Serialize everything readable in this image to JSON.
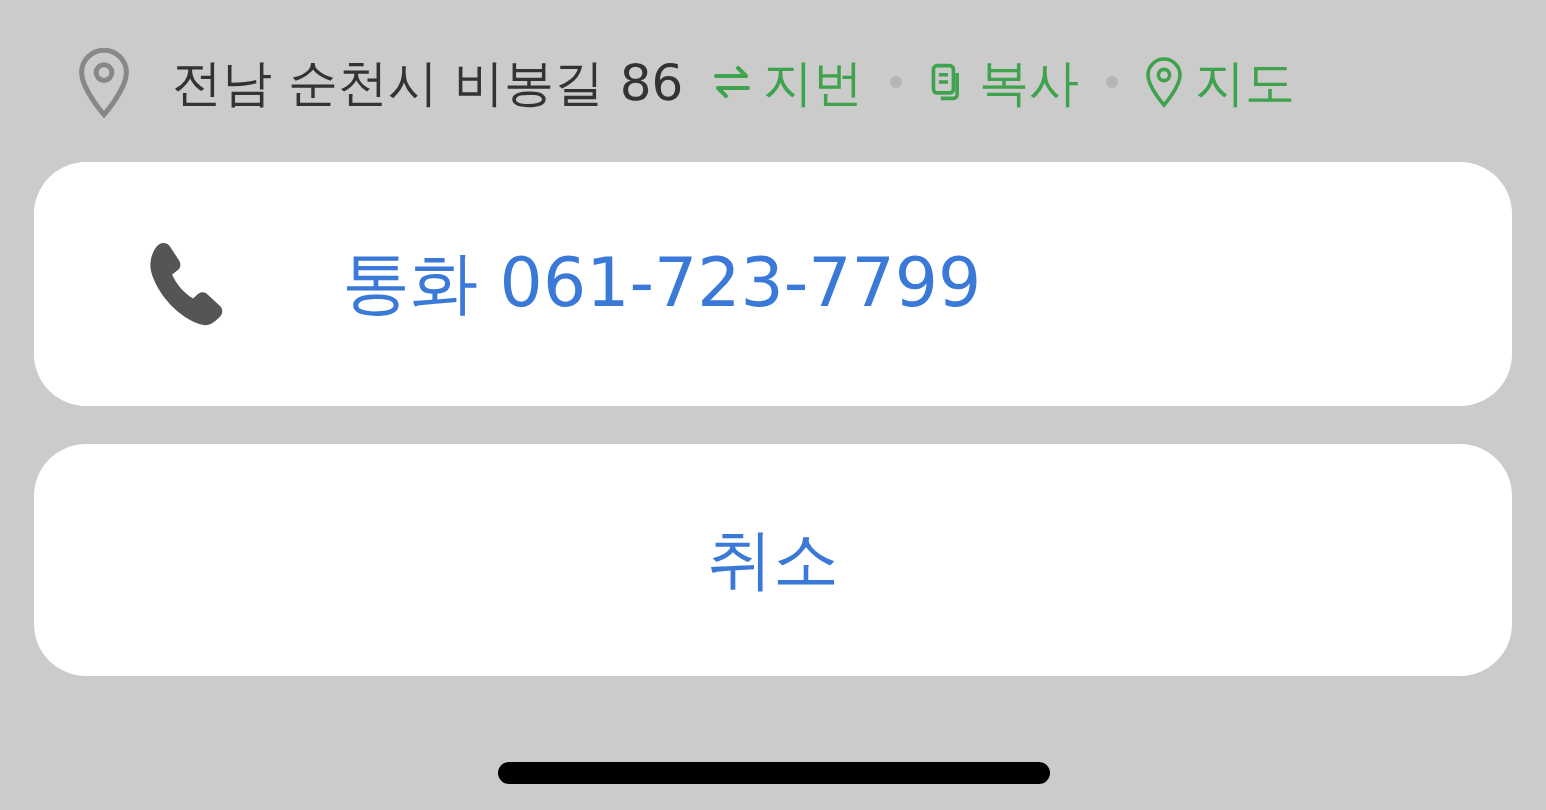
{
  "address": {
    "text": "전남 순천시 비봉길 86",
    "actions": [
      {
        "kind": "swap",
        "label": "지번"
      },
      {
        "kind": "copy",
        "label": "복사"
      },
      {
        "kind": "pin",
        "label": "지도"
      }
    ]
  },
  "sheet": {
    "actions": [
      {
        "kind": "phone",
        "label": "통화 061-723-7799"
      }
    ],
    "cancel": "취소"
  }
}
